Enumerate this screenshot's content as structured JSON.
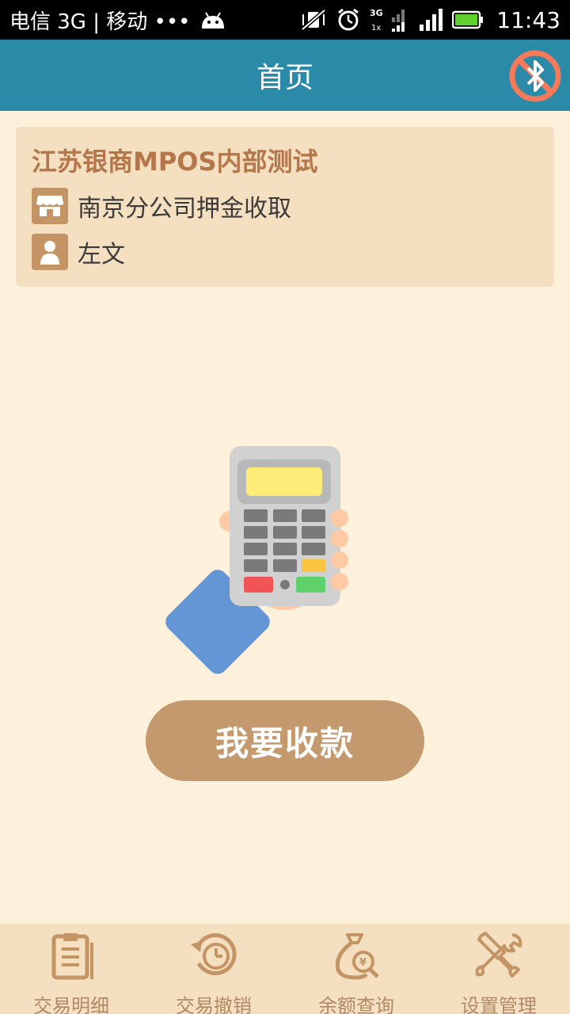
{
  "status_bar": {
    "carrier": "电信 3G | 移动 •••",
    "time": "11:43",
    "icons": [
      "android-icon",
      "vibrate-mute-icon",
      "alarm-icon",
      "3g-signal-icon",
      "signal-icon",
      "battery-icon"
    ]
  },
  "header": {
    "title": "首页",
    "bluetooth_icon": "bluetooth-disabled-icon"
  },
  "merchant": {
    "name": "江苏银商MPOS内部测试",
    "branch": "南京分公司押金收取",
    "operator": "左文",
    "branch_icon": "store-icon",
    "operator_icon": "user-icon"
  },
  "main": {
    "pay_button": "我要收款",
    "illustration": "pos-terminal-hand-card"
  },
  "bottom_nav": {
    "items": [
      {
        "label": "交易明细",
        "icon": "clipboard-icon"
      },
      {
        "label": "交易撤销",
        "icon": "undo-clock-icon"
      },
      {
        "label": "余额查询",
        "icon": "money-bag-search-icon"
      },
      {
        "label": "设置管理",
        "icon": "tools-icon"
      }
    ]
  },
  "colors": {
    "header": "#2a8aa8",
    "background": "#fdf1dc",
    "card": "#f4dfc0",
    "accent": "#c4996d",
    "merchant_title": "#b5764a",
    "bluetooth_off": "#f47a5a"
  }
}
